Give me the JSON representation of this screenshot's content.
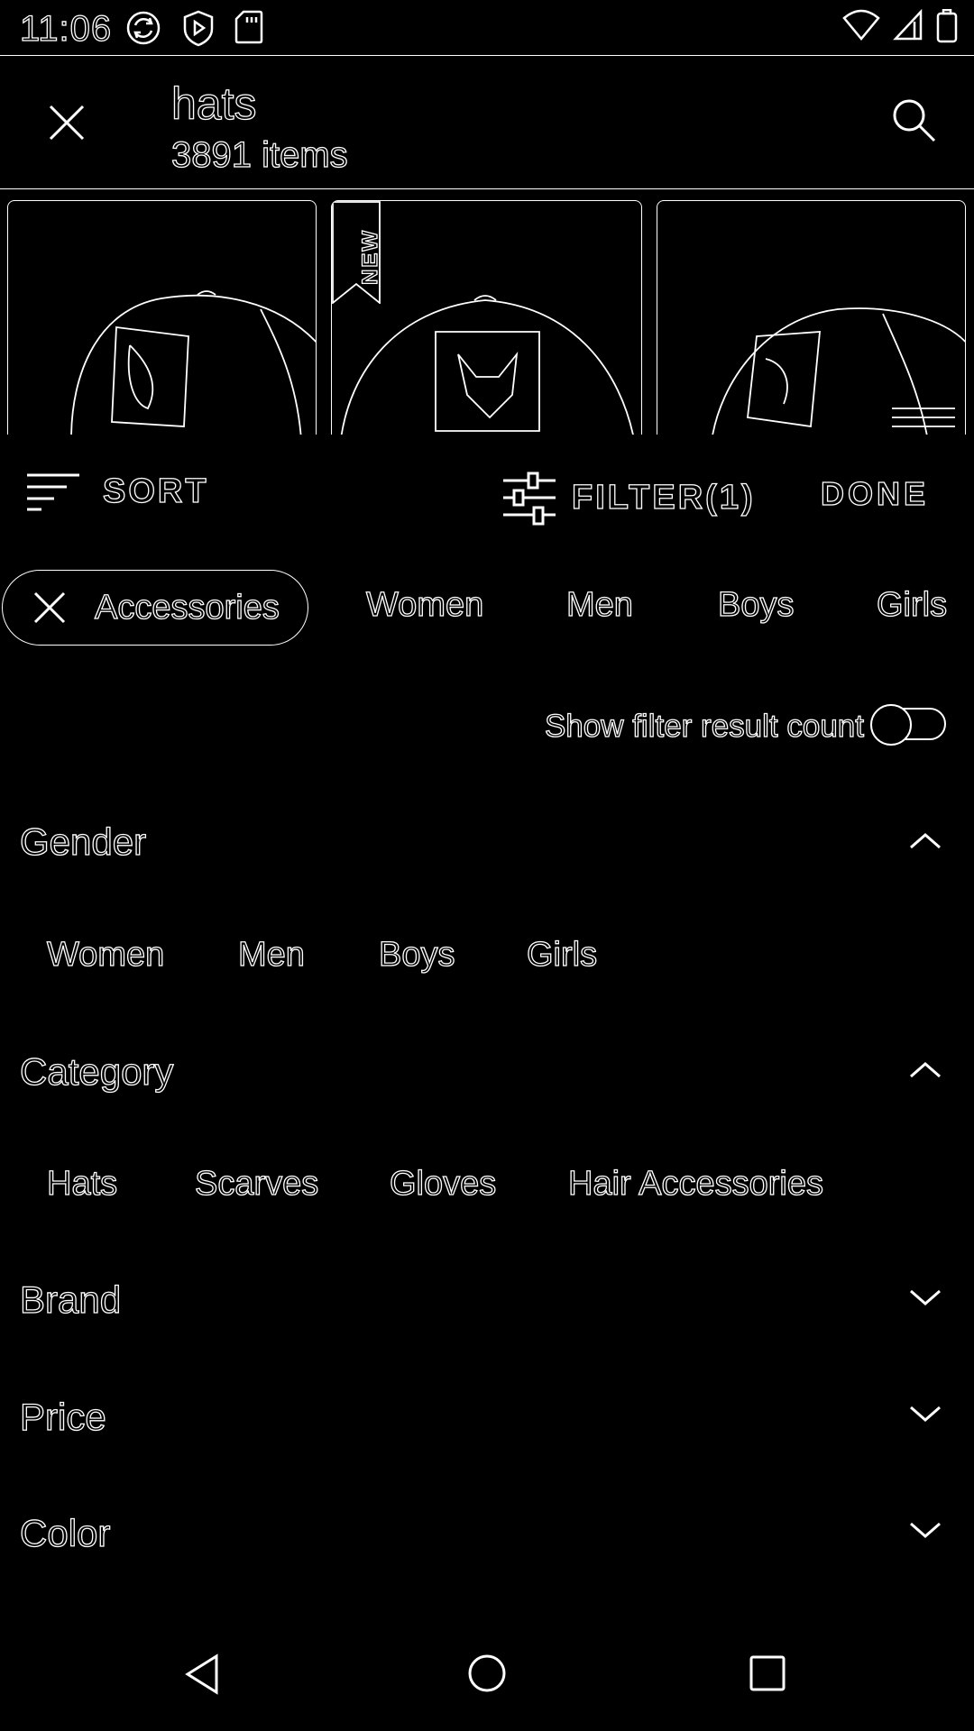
{
  "status_bar": {
    "time": "11:06",
    "left_icons": [
      "sync-icon",
      "shield-play-icon",
      "sd-card-icon"
    ],
    "right_icons": [
      "wifi-icon",
      "signal-icon",
      "battery-icon"
    ]
  },
  "search_header": {
    "query": "hats",
    "item_count": "3891 items"
  },
  "products": [
    {
      "label": "",
      "badge": ""
    },
    {
      "label": "",
      "badge": "NEW"
    },
    {
      "label": "",
      "badge": ""
    }
  ],
  "toolbar": {
    "sort_label": "SORT",
    "filter_label": "FILTER(1)",
    "done_label": "DONE"
  },
  "chips": {
    "active": "Accessories",
    "items": [
      "Women",
      "Men",
      "Boys",
      "Girls"
    ]
  },
  "filter_count": {
    "label": "Show filter result count",
    "enabled": false
  },
  "sections": {
    "gender": {
      "title": "Gender",
      "expanded": true,
      "options": [
        "Women",
        "Men",
        "Boys",
        "Girls"
      ]
    },
    "category": {
      "title": "Category",
      "expanded": true,
      "options": [
        "Hats",
        "Scarves",
        "Gloves",
        "Hair Accessories"
      ]
    },
    "brand": {
      "title": "Brand",
      "expanded": false
    },
    "price": {
      "title": "Price",
      "expanded": false
    },
    "color": {
      "title": "Color",
      "expanded": false
    }
  },
  "nav_bar": [
    "back-icon",
    "home-icon",
    "recents-icon"
  ]
}
